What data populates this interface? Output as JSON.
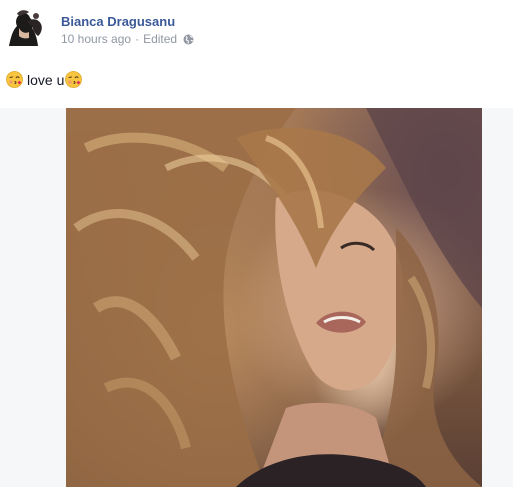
{
  "post": {
    "author": "Bianca Dragusanu",
    "timestamp": "10 hours ago",
    "separator": "·",
    "edited_label": "Edited",
    "privacy_icon": "globe-icon",
    "message": {
      "emoji_left": "kissing-emoji",
      "text": "love u",
      "emoji_right": "kissing-emoji"
    },
    "photo": {
      "description_icon": "photo"
    }
  },
  "colors": {
    "author_link": "#3b5998",
    "meta_text": "#9197a3",
    "body_text": "#141823",
    "photo_background": "#f6f7f8"
  }
}
